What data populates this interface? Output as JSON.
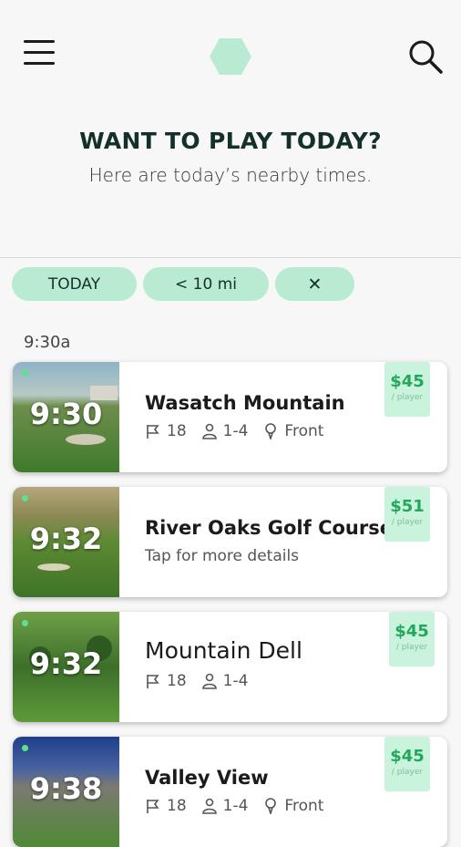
{
  "header": {
    "title": "WANT TO PLAY TODAY?",
    "subtitle": "Here are today’s nearby times."
  },
  "filters": [
    {
      "label": "TODAY"
    },
    {
      "label": "< 10 mi"
    },
    {
      "label": "✕"
    }
  ],
  "section_time": "9:30a",
  "cards": [
    {
      "time": "9:30",
      "name": "Wasatch Mountain",
      "holes": "18",
      "players": "1-4",
      "tee": "Front",
      "price": "$45",
      "per": "/ player"
    },
    {
      "time": "9:32",
      "name": "River Oaks Golf Course",
      "details": "Tap for more details",
      "price": "$51",
      "per": "/ player"
    },
    {
      "time": "9:32",
      "name": "Mountain Dell",
      "holes": "18",
      "players": "1-4",
      "price": "$45",
      "per": "/ player"
    },
    {
      "time": "9:38",
      "name": "Valley View",
      "holes": "18",
      "players": "1-4",
      "tee": "Front",
      "price": "$45",
      "per": "/ player"
    }
  ],
  "colors": {
    "accent": "#b8ebd2",
    "price_bg": "#c9f3dc",
    "price_text": "#22a85a"
  },
  "icons": [
    "menu-icon",
    "logo-hexagon-icon",
    "search-icon",
    "flag-icon",
    "person-icon",
    "tee-icon"
  ]
}
